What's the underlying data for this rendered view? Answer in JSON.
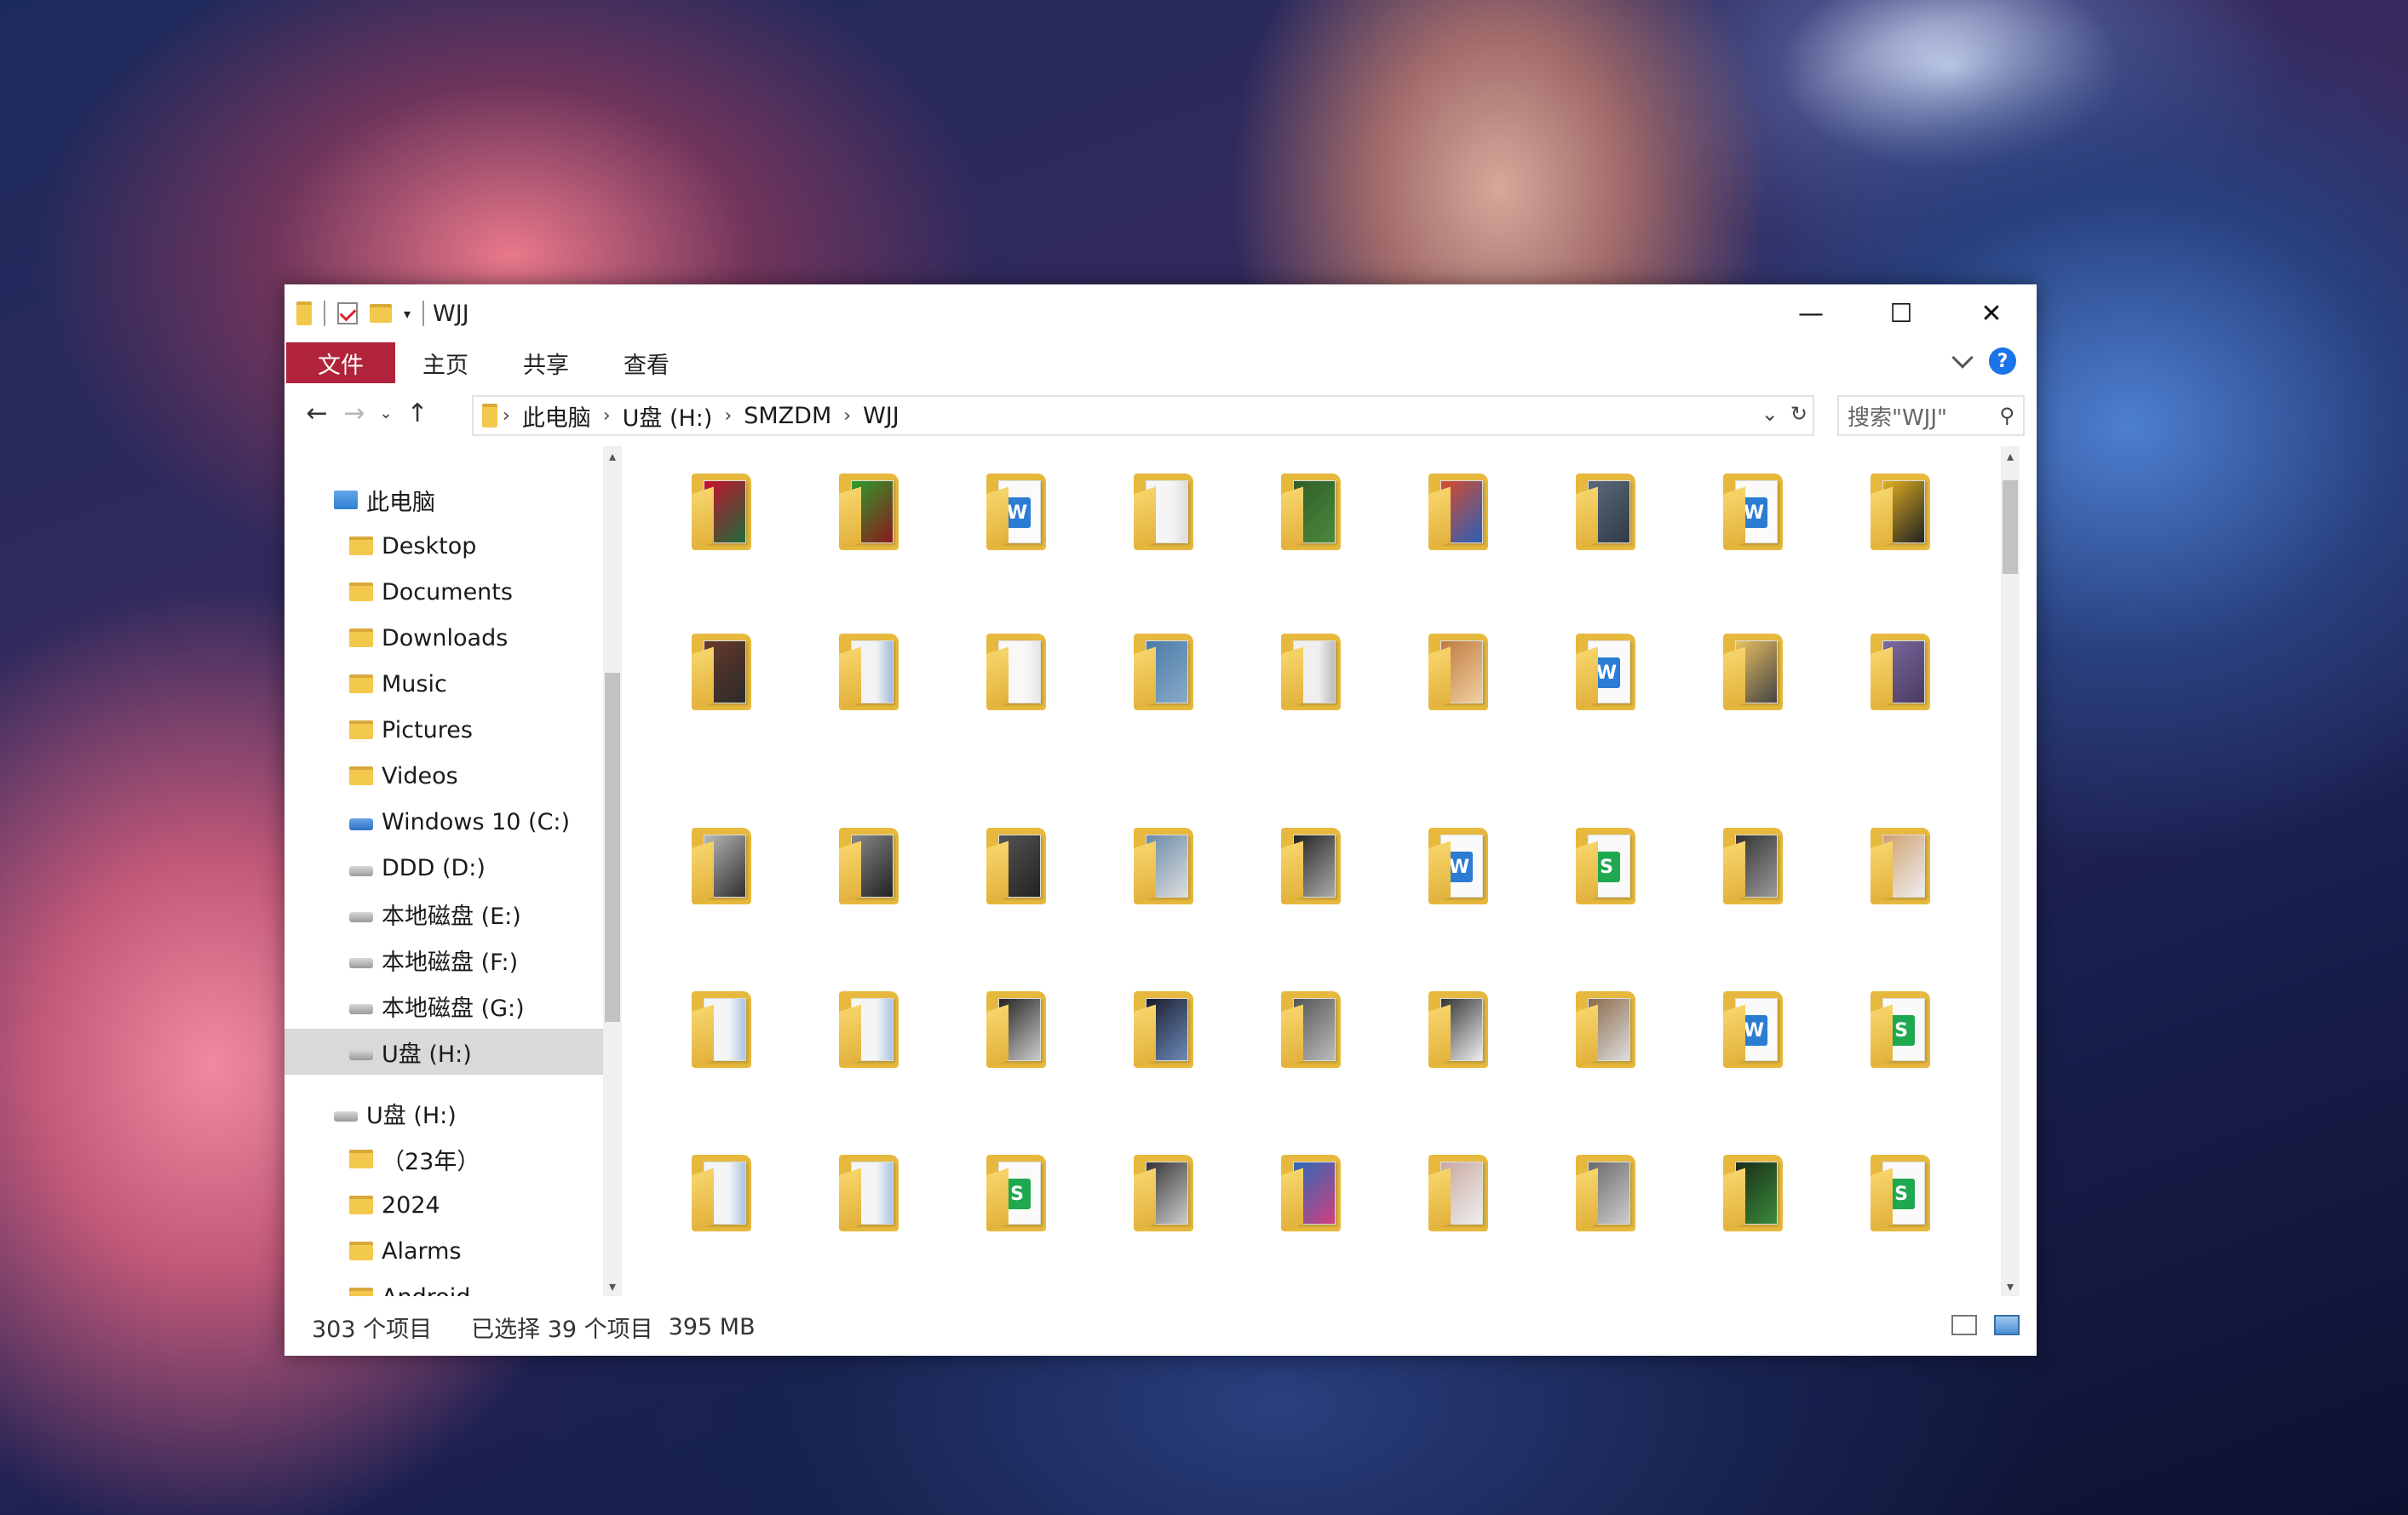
{
  "window": {
    "title": "WJJ",
    "buttons": {
      "minimize": "—",
      "maximize": "☐",
      "close": "✕"
    }
  },
  "ribbon": {
    "tabs": [
      {
        "label": "文件"
      },
      {
        "label": "主页"
      },
      {
        "label": "共享"
      },
      {
        "label": "查看"
      }
    ],
    "help_label": "?"
  },
  "address": {
    "crumbs": [
      "此电脑",
      "U盘 (H:)",
      "SMZDM",
      "WJJ"
    ],
    "search_placeholder": "搜索\"WJJ\""
  },
  "sidebar": {
    "items": [
      {
        "label": "此电脑",
        "icon": "pc-icon",
        "level": 0
      },
      {
        "label": "Desktop",
        "icon": "desktop-folder-icon",
        "level": 1
      },
      {
        "label": "Documents",
        "icon": "documents-folder-icon",
        "level": 1
      },
      {
        "label": "Downloads",
        "icon": "downloads-folder-icon",
        "level": 1
      },
      {
        "label": "Music",
        "icon": "music-folder-icon",
        "level": 1
      },
      {
        "label": "Pictures",
        "icon": "pictures-folder-icon",
        "level": 1
      },
      {
        "label": "Videos",
        "icon": "videos-folder-icon",
        "level": 1
      },
      {
        "label": "Windows 10 (C:)",
        "icon": "windows-drive-icon",
        "level": 1
      },
      {
        "label": "DDD (D:)",
        "icon": "drive-icon",
        "level": 1
      },
      {
        "label": "本地磁盘 (E:)",
        "icon": "drive-icon",
        "level": 1
      },
      {
        "label": "本地磁盘 (F:)",
        "icon": "drive-icon",
        "level": 1
      },
      {
        "label": "本地磁盘 (G:)",
        "icon": "drive-icon",
        "level": 1
      },
      {
        "label": "U盘 (H:)",
        "icon": "usb-drive-icon",
        "level": 1,
        "selected": true
      },
      {
        "label": "U盘 (H:)",
        "icon": "usb-drive-icon",
        "level": 0
      },
      {
        "label": "（23年）",
        "icon": "folder-icon",
        "level": 1
      },
      {
        "label": "2024",
        "icon": "folder-icon",
        "level": 1
      },
      {
        "label": "Alarms",
        "icon": "folder-icon",
        "level": 1
      },
      {
        "label": "Android",
        "icon": "folder-icon",
        "level": 1
      }
    ]
  },
  "status": {
    "item_count": "303 个项目",
    "selection": "已选择 39 个项目",
    "size": "395 MB"
  },
  "colors": {
    "file_tab": "#b0233a",
    "folder": "#e6b93e",
    "word": "#2b7cd3",
    "sheet": "#1ea84f",
    "selected_row": "#d9d9d9"
  },
  "tiles": [
    {
      "kind": "photo",
      "colors": [
        "#c8102e",
        "#1c6b3a"
      ]
    },
    {
      "kind": "photo",
      "colors": [
        "#2d9c2d",
        "#8b1a1a"
      ]
    },
    {
      "kind": "word",
      "colors": [
        "#2b7cd3",
        "#2b7cd3"
      ]
    },
    {
      "kind": "plain",
      "colors": [
        "#f5f5f5",
        "#dcdcdc"
      ]
    },
    {
      "kind": "photo",
      "colors": [
        "#2f5d2a",
        "#4c8a3b"
      ]
    },
    {
      "kind": "photo",
      "colors": [
        "#d94b2b",
        "#2a5fb8"
      ]
    },
    {
      "kind": "photo",
      "colors": [
        "#5b6a7a",
        "#2f3a48"
      ]
    },
    {
      "kind": "word",
      "colors": [
        "#2b7cd3",
        "#7ab5de"
      ]
    },
    {
      "kind": "photo",
      "colors": [
        "#e0b020",
        "#222222"
      ]
    },
    {
      "kind": "photo",
      "colors": [
        "#6a3a2a",
        "#2a2a2a"
      ]
    },
    {
      "kind": "plain",
      "colors": [
        "#f3f3f3",
        "#9fb8d8"
      ]
    },
    {
      "kind": "plain",
      "colors": [
        "#f8f8f8",
        "#e6e6e6"
      ]
    },
    {
      "kind": "photo",
      "colors": [
        "#4a7aa8",
        "#88aac8"
      ]
    },
    {
      "kind": "plain",
      "colors": [
        "#efefef",
        "#bcbcbc"
      ]
    },
    {
      "kind": "photo",
      "colors": [
        "#c07a40",
        "#f0d0a0"
      ]
    },
    {
      "kind": "word",
      "colors": [
        "#2b7cd3",
        "#d07020"
      ]
    },
    {
      "kind": "photo",
      "colors": [
        "#e8c060",
        "#444444"
      ]
    },
    {
      "kind": "photo",
      "colors": [
        "#7a6aa0",
        "#4a3a60"
      ]
    },
    {
      "kind": "photo",
      "colors": [
        "#b8b8b8",
        "#303030"
      ]
    },
    {
      "kind": "photo",
      "colors": [
        "#888888",
        "#222222"
      ]
    },
    {
      "kind": "photo",
      "colors": [
        "#555555",
        "#222222"
      ]
    },
    {
      "kind": "photo",
      "colors": [
        "#6a8aa8",
        "#dddddd"
      ]
    },
    {
      "kind": "photo",
      "colors": [
        "#222222",
        "#aaaaaa"
      ]
    },
    {
      "kind": "word",
      "colors": [
        "#2b7cd3",
        "#eeeeee"
      ]
    },
    {
      "kind": "sheet",
      "colors": [
        "#1ea84f",
        "#eeeeee"
      ]
    },
    {
      "kind": "photo",
      "colors": [
        "#333333",
        "#999999"
      ]
    },
    {
      "kind": "photo",
      "colors": [
        "#d0a070",
        "#eeeeee"
      ]
    },
    {
      "kind": "plain",
      "colors": [
        "#f5f5f5",
        "#a8c4e0"
      ]
    },
    {
      "kind": "plain",
      "colors": [
        "#f5f5f5",
        "#a8c4e0"
      ]
    },
    {
      "kind": "photo",
      "colors": [
        "#222222",
        "#cccccc"
      ]
    },
    {
      "kind": "photo",
      "colors": [
        "#1a1a2a",
        "#6a8ab8"
      ]
    },
    {
      "kind": "photo",
      "colors": [
        "#555555",
        "#bbbbbb"
      ]
    },
    {
      "kind": "photo",
      "colors": [
        "#333333",
        "#eeeeee"
      ]
    },
    {
      "kind": "photo",
      "colors": [
        "#8a6a4a",
        "#dddddd"
      ]
    },
    {
      "kind": "word",
      "colors": [
        "#2b7cd3",
        "#eeeeee"
      ]
    },
    {
      "kind": "sheet",
      "colors": [
        "#1ea84f",
        "#eeeeee"
      ]
    },
    {
      "kind": "plain",
      "colors": [
        "#f5f5f5",
        "#a8c4e0"
      ]
    },
    {
      "kind": "plain",
      "colors": [
        "#f5f5f5",
        "#a8c4e0"
      ]
    },
    {
      "kind": "sheet",
      "colors": [
        "#1ea84f",
        "#eeeeee"
      ]
    },
    {
      "kind": "photo",
      "colors": [
        "#333333",
        "#cccccc"
      ]
    },
    {
      "kind": "photo",
      "colors": [
        "#2a6ab8",
        "#d04080"
      ]
    },
    {
      "kind": "photo",
      "colors": [
        "#c8a8a0",
        "#eeeeee"
      ]
    },
    {
      "kind": "photo",
      "colors": [
        "#6a6a6a",
        "#cccccc"
      ]
    },
    {
      "kind": "photo",
      "colors": [
        "#1a2a1a",
        "#3a8a3a"
      ]
    },
    {
      "kind": "sheet",
      "colors": [
        "#1ea84f",
        "#1ea84f"
      ]
    }
  ]
}
